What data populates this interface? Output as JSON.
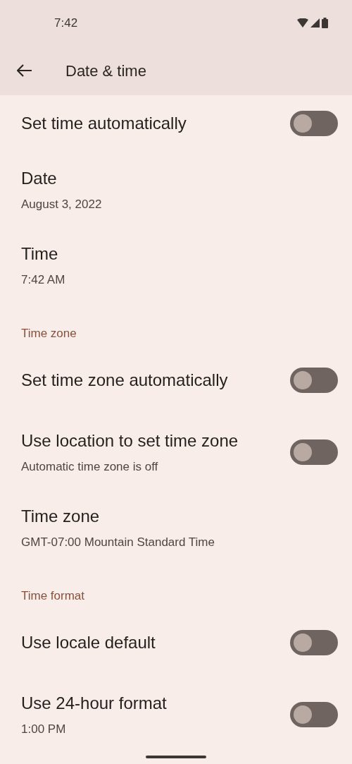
{
  "status_bar": {
    "time": "7:42"
  },
  "app_bar": {
    "title": "Date & time"
  },
  "rows": [
    {
      "kind": "toggle",
      "title": "Set time automatically",
      "on": false
    },
    {
      "kind": "item",
      "title": "Date",
      "subtitle": "August 3, 2022"
    },
    {
      "kind": "item",
      "title": "Time",
      "subtitle": "7:42 AM"
    },
    {
      "kind": "header",
      "title": "Time zone"
    },
    {
      "kind": "toggle",
      "title": "Set time zone automatically",
      "on": false
    },
    {
      "kind": "toggle",
      "title": "Use location to set time zone",
      "subtitle": "Automatic time zone is off",
      "on": false
    },
    {
      "kind": "item",
      "title": "Time zone",
      "subtitle": "GMT-07:00 Mountain Standard Time"
    },
    {
      "kind": "header",
      "title": "Time format"
    },
    {
      "kind": "toggle",
      "title": "Use locale default",
      "on": false
    },
    {
      "kind": "toggle",
      "title": "Use 24-hour format",
      "subtitle": "1:00 PM",
      "on": false
    }
  ]
}
